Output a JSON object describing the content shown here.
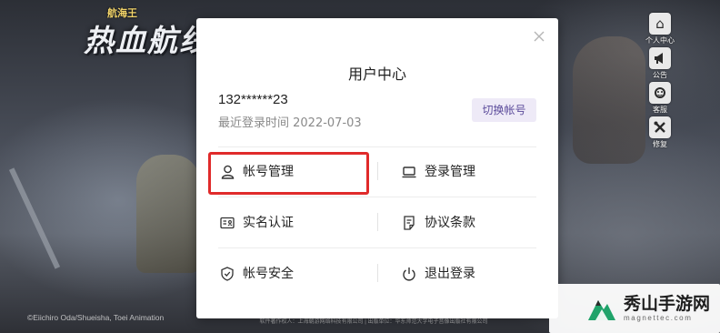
{
  "game": {
    "logo_small": "航海王",
    "logo_main": "热血航线",
    "copyright_left": "©Eiichiro Oda/Shueisha, Toei Animation",
    "copyright_bottom": "软件著作权人：上海朝游网络科技有限公司 | 出版单位：华东师范大学电子音像出版社有限公司",
    "menu": [
      {
        "label": "个人中心",
        "icon": "home-icon",
        "glyph": "⌂"
      },
      {
        "label": "公告",
        "icon": "megaphone-icon",
        "glyph": "📢"
      },
      {
        "label": "客服",
        "icon": "headset-icon",
        "glyph": "☺"
      },
      {
        "label": "修复",
        "icon": "wrench-icon",
        "glyph": "✖"
      }
    ]
  },
  "modal": {
    "title": "用户中心",
    "account_id": "132******23",
    "last_login": "最近登录时间 2022-07-03",
    "switch_button": "切换帐号",
    "items": [
      {
        "label": "帐号管理",
        "icon": "user-icon"
      },
      {
        "label": "登录管理",
        "icon": "laptop-icon"
      },
      {
        "label": "实名认证",
        "icon": "id-card-icon"
      },
      {
        "label": "协议条款",
        "icon": "document-icon"
      },
      {
        "label": "帐号安全",
        "icon": "shield-icon"
      },
      {
        "label": "退出登录",
        "icon": "power-icon"
      }
    ],
    "accent_color": "#5a4a9a",
    "highlight_color": "#e02a2a"
  },
  "watermark": {
    "title": "秀山手游网",
    "url": "magnettec.com",
    "brand_color": "#1fa36a"
  }
}
